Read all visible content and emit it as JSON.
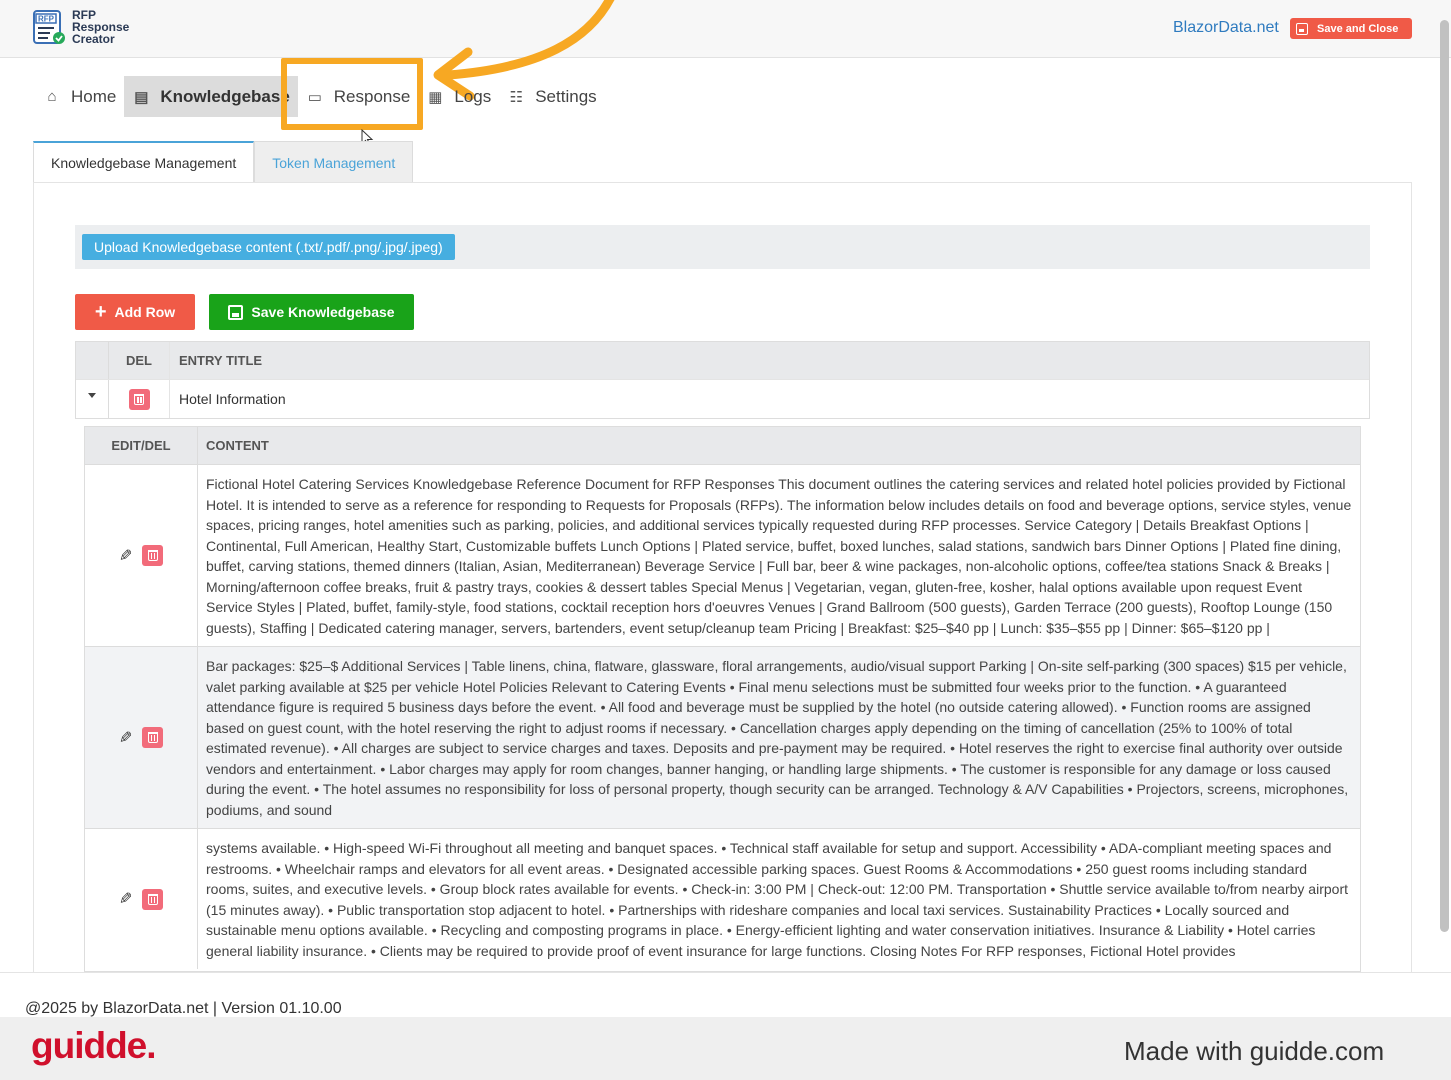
{
  "app": {
    "logo_lines": [
      "RFP",
      "Response",
      "Creator"
    ],
    "logo_badge": "RFP",
    "brand_link": "BlazorData.net",
    "save_close_label": "Save and Close"
  },
  "nav": {
    "items": [
      {
        "label": "Home",
        "icon": "home-icon"
      },
      {
        "label": "Knowledgebase",
        "icon": "book-icon"
      },
      {
        "label": "Response",
        "icon": "window-icon"
      },
      {
        "label": "Logs",
        "icon": "document-icon"
      },
      {
        "label": "Settings",
        "icon": "table-icon"
      }
    ]
  },
  "tabs": [
    {
      "label": "Knowledgebase Management"
    },
    {
      "label": "Token Management"
    }
  ],
  "upload": {
    "label": "Upload Knowledgebase content (.txt/.pdf/.png/.jpg/.jpeg)"
  },
  "toolbar": {
    "add_row_label": "Add Row",
    "save_kb_label": "Save Knowledgebase"
  },
  "grid": {
    "headers": {
      "del": "DEL",
      "title": "ENTRY TITLE"
    },
    "rows": [
      {
        "title": "Hotel Information"
      }
    ]
  },
  "detail": {
    "headers": {
      "edit": "EDIT/DEL",
      "content": "CONTENT"
    },
    "rows": [
      {
        "content": "Fictional Hotel Catering Services Knowledgebase Reference Document for RFP Responses This document outlines the catering services and related hotel policies provided by Fictional Hotel. It is intended to serve as a reference for responding to Requests for Proposals (RFPs). The information below includes details on food and beverage options, service styles, venue spaces, pricing ranges, hotel amenities such as parking, policies, and additional services typically requested during RFP processes. Service Category | Details Breakfast Options | Continental, Full American, Healthy Start, Customizable buffets Lunch Options | Plated service, buffet, boxed lunches, salad stations, sandwich bars Dinner Options | Plated fine dining, buffet, carving stations, themed dinners (Italian, Asian, Mediterranean) Beverage Service | Full bar, beer & wine packages, non-alcoholic options, coffee/tea stations Snack & Breaks | Morning/afternoon coffee breaks, fruit & pastry trays, cookies & dessert tables Special Menus | Vegetarian, vegan, gluten-free, kosher, halal options available upon request Event Service Styles | Plated, buffet, family-style, food stations, cocktail reception hors d'oeuvres Venues | Grand Ballroom (500 guests), Garden Terrace (200 guests), Rooftop Lounge (150 guests), Staffing | Dedicated catering manager, servers, bartenders, event setup/cleanup team Pricing | Breakfast: $25–$40 pp | Lunch: $35–$55 pp | Dinner: $65–$120 pp |"
      },
      {
        "content": "Bar packages: $25–$ Additional Services | Table linens, china, flatware, glassware, floral arrangements, audio/visual support Parking | On-site self-parking (300 spaces) $15 per vehicle, valet parking available at $25 per vehicle Hotel Policies Relevant to Catering Events • Final menu selections must be submitted four weeks prior to the function. • A guaranteed attendance figure is required 5 business days before the event. • All food and beverage must be supplied by the hotel (no outside catering allowed). • Function rooms are assigned based on guest count, with the hotel reserving the right to adjust rooms if necessary. • Cancellation charges apply depending on the timing of cancellation (25% to 100% of total estimated revenue). • All charges are subject to service charges and taxes. Deposits and pre-payment may be required. • Hotel reserves the right to exercise final authority over outside vendors and entertainment. • Labor charges may apply for room changes, banner hanging, or handling large shipments. • The customer is responsible for any damage or loss caused during the event. • The hotel assumes no responsibility for loss of personal property, though security can be arranged. Technology & A/V Capabilities • Projectors, screens, microphones, podiums, and sound"
      },
      {
        "content": "systems available. • High-speed Wi-Fi throughout all meeting and banquet spaces. • Technical staff available for setup and support. Accessibility • ADA-compliant meeting spaces and restrooms. • Wheelchair ramps and elevators for all event areas. • Designated accessible parking spaces. Guest Rooms & Accommodations • 250 guest rooms including standard rooms, suites, and executive levels. • Group block rates available for events. • Check-in: 3:00 PM | Check-out: 12:00 PM. Transportation • Shuttle service available to/from nearby airport (15 minutes away). • Public transportation stop adjacent to hotel. • Partnerships with rideshare companies and local taxi services. Sustainability Practices • Locally sourced and sustainable menu options available. • Recycling and composting programs in place. • Energy-efficient lighting and water conservation initiatives. Insurance & Liability • Hotel carries general liability insurance. • Clients may be required to provide proof of event insurance for large functions. Closing Notes For RFP responses, Fictional Hotel provides"
      }
    ]
  },
  "footer": {
    "text": "@2025 by BlazorData.net | Version 01.10.00"
  },
  "watermark": {
    "logo": "guidde.",
    "made_with": "Made with guidde.com"
  },
  "colors": {
    "accent_orange": "#f7a823",
    "danger": "#f05a47",
    "success": "#19a319",
    "info": "#46aee0"
  }
}
